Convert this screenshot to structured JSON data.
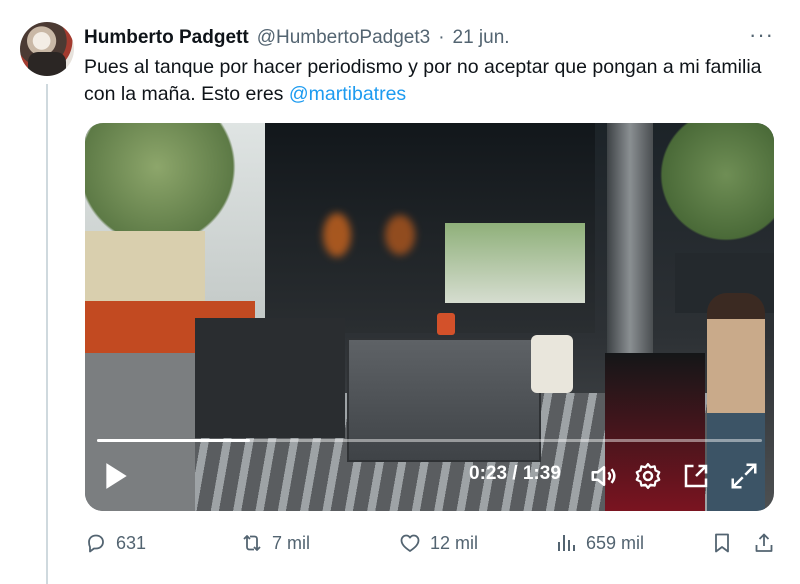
{
  "tweet": {
    "author_name": "Humberto Padgett",
    "handle": "@HumbertoPadget3",
    "separator": "·",
    "date": "21 jun.",
    "more": "···",
    "text": "Pues al tanque por hacer periodismo y por no aceptar que pongan a mi familia con la maña. Esto eres ",
    "mention": "@martibatres"
  },
  "video": {
    "time": "0:23 / 1:39",
    "progress": 0.23,
    "controls": {
      "play": "play-icon",
      "volume": "volume-icon",
      "settings": "gear-icon",
      "pip": "picture-in-picture-icon",
      "fullscreen": "fullscreen-icon"
    }
  },
  "actions": {
    "replies": "631",
    "retweets": "7 mil",
    "likes": "12 mil",
    "views": "659 mil"
  },
  "colors": {
    "accent": "#1d9bf0",
    "secondary_text": "#536471",
    "thread_line": "#cfd9de"
  }
}
